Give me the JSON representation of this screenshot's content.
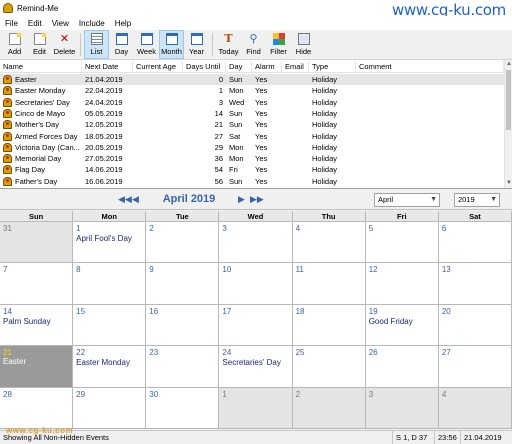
{
  "window": {
    "title": "Remind-Me",
    "watermark": "www.cg-ku.com"
  },
  "menu": [
    "File",
    "Edit",
    "View",
    "Include",
    "Help"
  ],
  "toolbar": {
    "add": "Add",
    "edit": "Edit",
    "delete": "Delete",
    "list": "List",
    "day": "Day",
    "week": "Week",
    "month": "Month",
    "year": "Year",
    "today": "Today",
    "find": "Find",
    "filter": "Filter",
    "hide": "Hide"
  },
  "list": {
    "columns": [
      "Name",
      "Next Date",
      "Current Age",
      "Days Until",
      "Day",
      "Alarm",
      "Email",
      "Type",
      "Comment"
    ],
    "rows": [
      {
        "name": "Easter",
        "date": "21.04.2019",
        "age": "",
        "until": "0",
        "day": "Sun",
        "alarm": "Yes",
        "email": "",
        "type": "Holiday",
        "comment": ""
      },
      {
        "name": "Easter Monday",
        "date": "22.04.2019",
        "age": "",
        "until": "1",
        "day": "Mon",
        "alarm": "Yes",
        "email": "",
        "type": "Holiday",
        "comment": ""
      },
      {
        "name": "Secretaries' Day",
        "date": "24.04.2019",
        "age": "",
        "until": "3",
        "day": "Wed",
        "alarm": "Yes",
        "email": "",
        "type": "Holiday",
        "comment": ""
      },
      {
        "name": "Cinco de Mayo",
        "date": "05.05.2019",
        "age": "",
        "until": "14",
        "day": "Sun",
        "alarm": "Yes",
        "email": "",
        "type": "Holiday",
        "comment": ""
      },
      {
        "name": "Mother's Day",
        "date": "12.05.2019",
        "age": "",
        "until": "21",
        "day": "Sun",
        "alarm": "Yes",
        "email": "",
        "type": "Holiday",
        "comment": ""
      },
      {
        "name": "Armed Forces Day",
        "date": "18.05.2019",
        "age": "",
        "until": "27",
        "day": "Sat",
        "alarm": "Yes",
        "email": "",
        "type": "Holiday",
        "comment": ""
      },
      {
        "name": "Victoria Day (Can...",
        "date": "20.05.2019",
        "age": "",
        "until": "29",
        "day": "Mon",
        "alarm": "Yes",
        "email": "",
        "type": "Holiday",
        "comment": ""
      },
      {
        "name": "Memorial Day",
        "date": "27.05.2019",
        "age": "",
        "until": "36",
        "day": "Mon",
        "alarm": "Yes",
        "email": "",
        "type": "Holiday",
        "comment": ""
      },
      {
        "name": "Flag Day",
        "date": "14.06.2019",
        "age": "",
        "until": "54",
        "day": "Fri",
        "alarm": "Yes",
        "email": "",
        "type": "Holiday",
        "comment": ""
      },
      {
        "name": "Father's Day",
        "date": "16.06.2019",
        "age": "",
        "until": "56",
        "day": "Sun",
        "alarm": "Yes",
        "email": "",
        "type": "Holiday",
        "comment": ""
      }
    ]
  },
  "calendar": {
    "title": "April 2019",
    "month_select": "April",
    "year_select": "2019",
    "weekdays": [
      "Sun",
      "Mon",
      "Tue",
      "Wed",
      "Thu",
      "Fri",
      "Sat"
    ],
    "weeks": [
      [
        {
          "n": "31",
          "other": true,
          "event": ""
        },
        {
          "n": "1",
          "event": "April Fool's Day"
        },
        {
          "n": "2",
          "event": ""
        },
        {
          "n": "3",
          "event": ""
        },
        {
          "n": "4",
          "event": ""
        },
        {
          "n": "5",
          "event": ""
        },
        {
          "n": "6",
          "event": ""
        }
      ],
      [
        {
          "n": "7",
          "event": ""
        },
        {
          "n": "8",
          "event": ""
        },
        {
          "n": "9",
          "event": ""
        },
        {
          "n": "10",
          "event": ""
        },
        {
          "n": "11",
          "event": ""
        },
        {
          "n": "12",
          "event": ""
        },
        {
          "n": "13",
          "event": ""
        }
      ],
      [
        {
          "n": "14",
          "event": "Palm Sunday"
        },
        {
          "n": "15",
          "event": ""
        },
        {
          "n": "16",
          "event": ""
        },
        {
          "n": "17",
          "event": ""
        },
        {
          "n": "18",
          "event": ""
        },
        {
          "n": "19",
          "event": "Good Friday"
        },
        {
          "n": "20",
          "event": ""
        }
      ],
      [
        {
          "n": "21",
          "today": true,
          "event": "Easter"
        },
        {
          "n": "22",
          "event": "Easter Monday"
        },
        {
          "n": "23",
          "event": ""
        },
        {
          "n": "24",
          "event": "Secretaries' Day"
        },
        {
          "n": "25",
          "event": ""
        },
        {
          "n": "26",
          "event": ""
        },
        {
          "n": "27",
          "event": ""
        }
      ],
      [
        {
          "n": "28",
          "event": ""
        },
        {
          "n": "29",
          "event": ""
        },
        {
          "n": "30",
          "event": ""
        },
        {
          "n": "1",
          "other": true,
          "event": ""
        },
        {
          "n": "2",
          "other": true,
          "event": ""
        },
        {
          "n": "3",
          "other": true,
          "event": ""
        },
        {
          "n": "4",
          "other": true,
          "event": ""
        }
      ]
    ]
  },
  "status": {
    "message": "Showing All Non-Hidden Events",
    "position": "S 1, D 37",
    "time": "23:56",
    "date": "21.04.2019",
    "mark": "www.cg-ku.com"
  },
  "colors": {
    "accent": "#3a63a8",
    "today_cell": "#9a9a9a",
    "selected_tool": "#cce4f7"
  }
}
